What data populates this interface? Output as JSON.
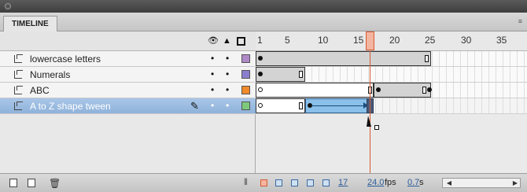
{
  "panel": {
    "tab_label": "TIMELINE",
    "menu_icon": "≡"
  },
  "header": {
    "eye_icon": "●",
    "lock_icon": "🔒"
  },
  "ruler": {
    "labels": [
      "1",
      "5",
      "10",
      "15",
      "20",
      "25",
      "30",
      "35"
    ],
    "current_frame": 17
  },
  "layers": [
    {
      "name": "lowercase letters",
      "color": "#b08ac8",
      "visible": "•",
      "locked": "•"
    },
    {
      "name": "Numerals",
      "color": "#8a7fcf",
      "visible": "•",
      "locked": "•"
    },
    {
      "name": "ABC",
      "color": "#f08a2a",
      "visible": "•",
      "locked": "•"
    },
    {
      "name": "A to Z shape tween",
      "color": "#7ec87e",
      "visible": "•",
      "locked": "•",
      "selected": true
    }
  ],
  "status": {
    "current_frame": "17",
    "fps_value": "24.0",
    "fps_unit": "fps",
    "time_value": "0.7",
    "time_unit": "s"
  },
  "colors": {
    "playhead": "#d75a30",
    "tween": "#8ac0ea",
    "selected_row": "#a9c6e8"
  }
}
